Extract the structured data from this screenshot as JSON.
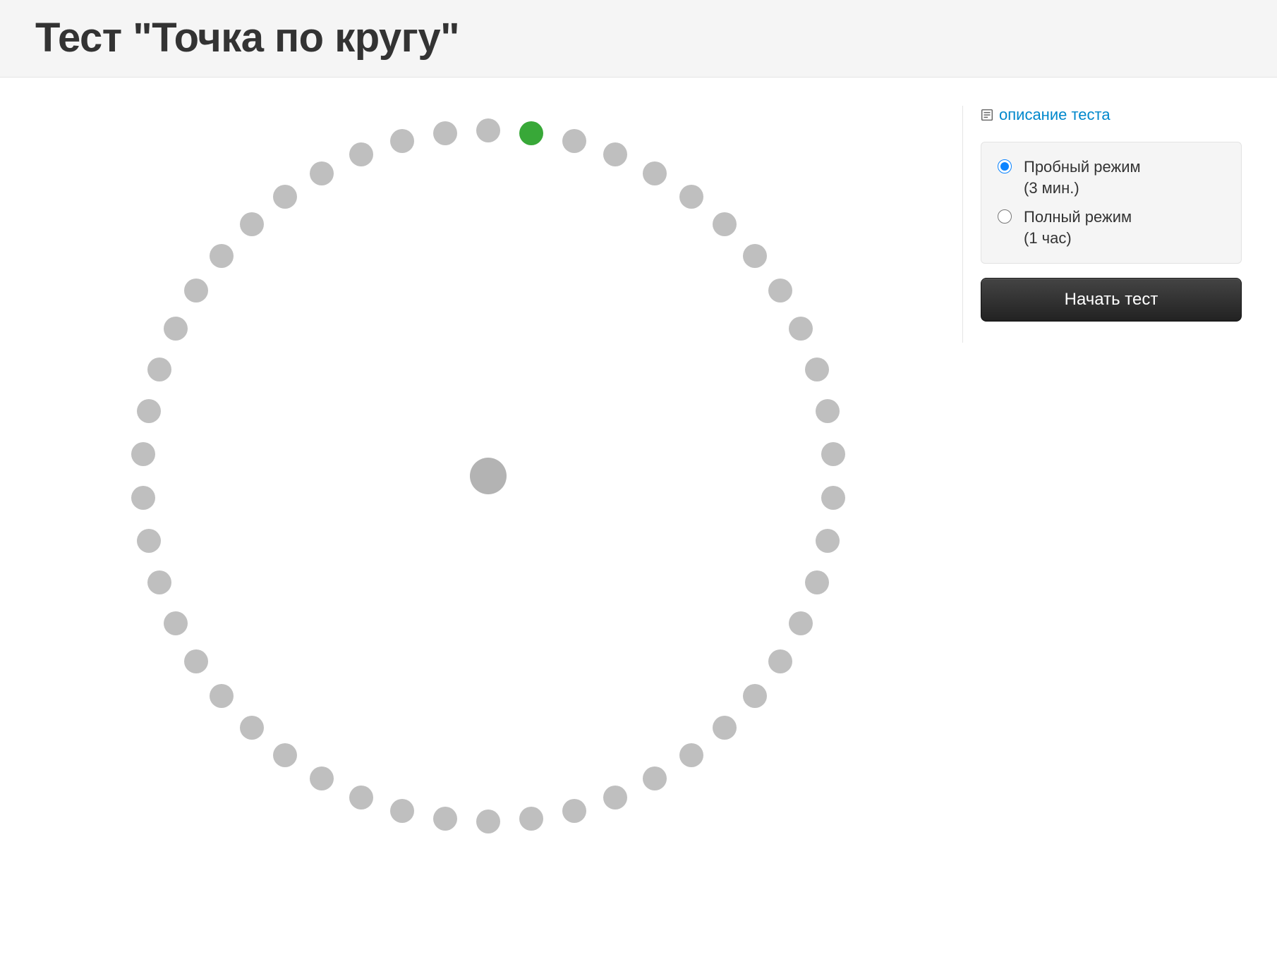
{
  "header": {
    "title": "Тест \"Точка по кругу\""
  },
  "circle": {
    "dot_count": 50,
    "active_index": 1,
    "colors": {
      "inactive": "#bfbfbf",
      "active": "#38a838",
      "center": "#b3b3b3"
    }
  },
  "sidebar": {
    "description_link": "описание теста",
    "modes": [
      {
        "label": "Пробный режим",
        "duration": "(3 мин.)",
        "selected": true
      },
      {
        "label": "Полный режим",
        "duration": "(1 час)",
        "selected": false
      }
    ],
    "start_button": "Начать тест"
  }
}
